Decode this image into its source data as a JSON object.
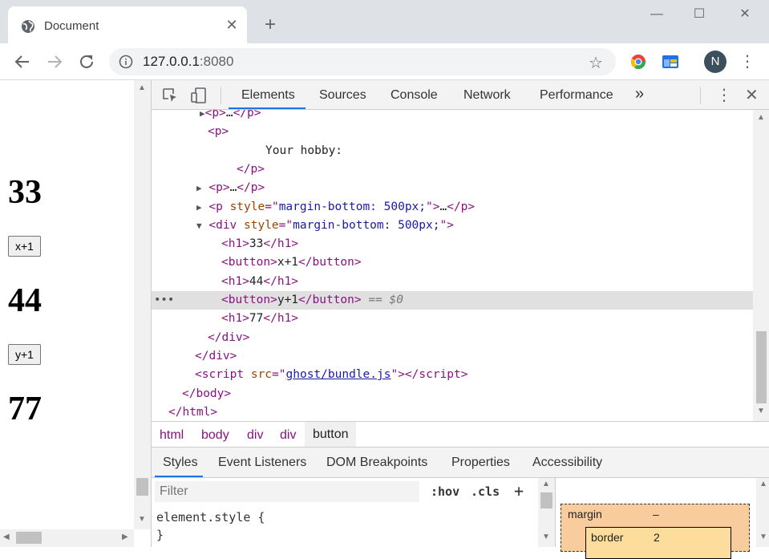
{
  "browser": {
    "tab_title": "Document",
    "tab_close": "✕",
    "new_tab": "+",
    "url_host": "127.0.0.1",
    "url_port": ":8080",
    "avatar_letter": "N",
    "window_controls": {
      "minimize": "—",
      "maximize": "☐",
      "close": "✕"
    }
  },
  "page": {
    "items": [
      {
        "kind": "h1",
        "text": "33"
      },
      {
        "kind": "button",
        "text": "x+1"
      },
      {
        "kind": "h1",
        "text": "44"
      },
      {
        "kind": "button",
        "text": "y+1"
      },
      {
        "kind": "h1",
        "text": "77"
      }
    ]
  },
  "devtools": {
    "tabs": [
      "Elements",
      "Sources",
      "Console",
      "Network",
      "Performance"
    ],
    "more_tabs": "»",
    "dom_lines": [
      {
        "html": "<span class='tri'>▶</span><span class='tag'>&lt;p&gt;</span>…<span class='tag'>&lt;/p&gt;</span>",
        "indent": 248
      },
      {
        "html": "<span class='tag'>&lt;p&gt;</span>",
        "indent": 258
      },
      {
        "html": "<span class='txt'>Your hobby:</span>",
        "indent": 330
      },
      {
        "html": "<span class='tag'>&lt;/p&gt;</span>",
        "indent": 294
      },
      {
        "html": "<span class='tri'>▶</span> <span class='tag'>&lt;p&gt;</span>…<span class='tag'>&lt;/p&gt;</span>",
        "indent": 244
      },
      {
        "html": "<span class='tri'>▶</span> <span class='tag'>&lt;p </span><span class='attr'>style</span><span class='tag'>=\"</span><span class='val'>margin-bottom: 500px;</span><span class='tag'>\"&gt;</span>…<span class='tag'>&lt;/p&gt;</span>",
        "indent": 244
      },
      {
        "html": "<span class='tri'>▼</span> <span class='tag'>&lt;div </span><span class='attr'>style</span><span class='tag'>=\"</span><span class='val'>margin-bottom: 500px;</span><span class='tag'>\"&gt;</span>",
        "indent": 244
      },
      {
        "html": "<span class='tag'>&lt;h1&gt;</span>33<span class='tag'>&lt;/h1&gt;</span>",
        "indent": 275
      },
      {
        "html": "<span class='tag'>&lt;button&gt;</span>x+1<span class='tag'>&lt;/button&gt;</span>",
        "indent": 275
      },
      {
        "html": "<span class='tag'>&lt;h1&gt;</span>44<span class='tag'>&lt;/h1&gt;</span>",
        "indent": 275
      },
      {
        "html": "<span class='tag'>&lt;button&gt;</span>y+1<span class='tag'>&lt;/button&gt;</span> <span class='dollar'>== $0</span>",
        "indent": 275,
        "selected": true
      },
      {
        "html": "<span class='tag'>&lt;h1&gt;</span>77<span class='tag'>&lt;/h1&gt;</span>",
        "indent": 275
      },
      {
        "html": "<span class='tag'>&lt;/div&gt;</span>",
        "indent": 258
      },
      {
        "html": "<span class='tag'>&lt;/div&gt;</span>",
        "indent": 242
      },
      {
        "html": "<span class='tag'>&lt;script </span><span class='attr'>src</span><span class='tag'>=\"</span><span class='link'>ghost/bundle.js</span><span class='tag'>\"&gt;&lt;/script&gt;</span>",
        "indent": 242
      },
      {
        "html": "<span class='tag'>&lt;/body&gt;</span>",
        "indent": 226
      },
      {
        "html": "<span class='tag'>&lt;/html&gt;</span>",
        "indent": 209
      }
    ],
    "breadcrumbs": [
      "html",
      "body",
      "div",
      "div",
      "button"
    ],
    "subtabs": [
      "Styles",
      "Event Listeners",
      "DOM Breakpoints",
      "Properties",
      "Accessibility"
    ],
    "filter_placeholder": "Filter",
    "hov": ":hov",
    "cls": ".cls",
    "plus": "+",
    "rule_open": "element.style {",
    "rule_close": "}",
    "box_model": {
      "margin_label": "margin",
      "margin_value": "–",
      "border_label": "border",
      "border_value": "2"
    }
  }
}
